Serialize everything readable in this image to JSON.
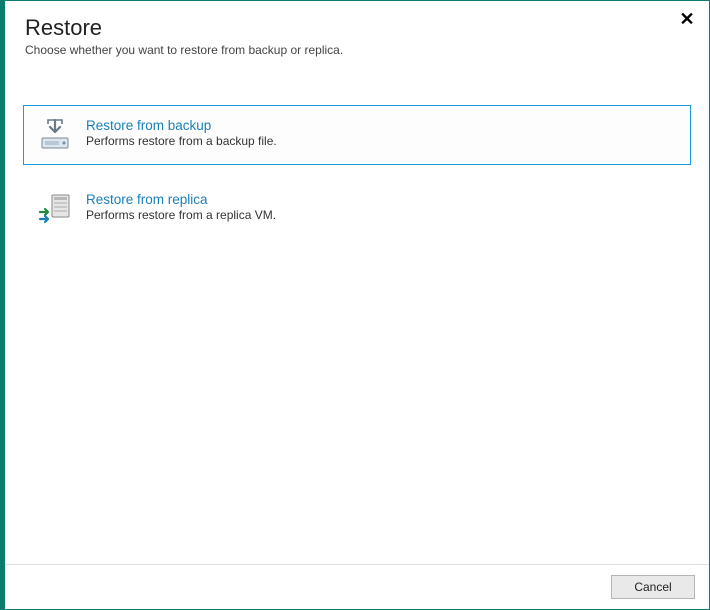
{
  "header": {
    "title": "Restore",
    "subtitle": "Choose whether you want to restore from backup or replica."
  },
  "options": {
    "backup": {
      "title": "Restore from backup",
      "description": "Performs restore from a backup file."
    },
    "replica": {
      "title": "Restore from replica",
      "description": "Performs restore from a replica VM."
    }
  },
  "footer": {
    "cancel_label": "Cancel"
  }
}
